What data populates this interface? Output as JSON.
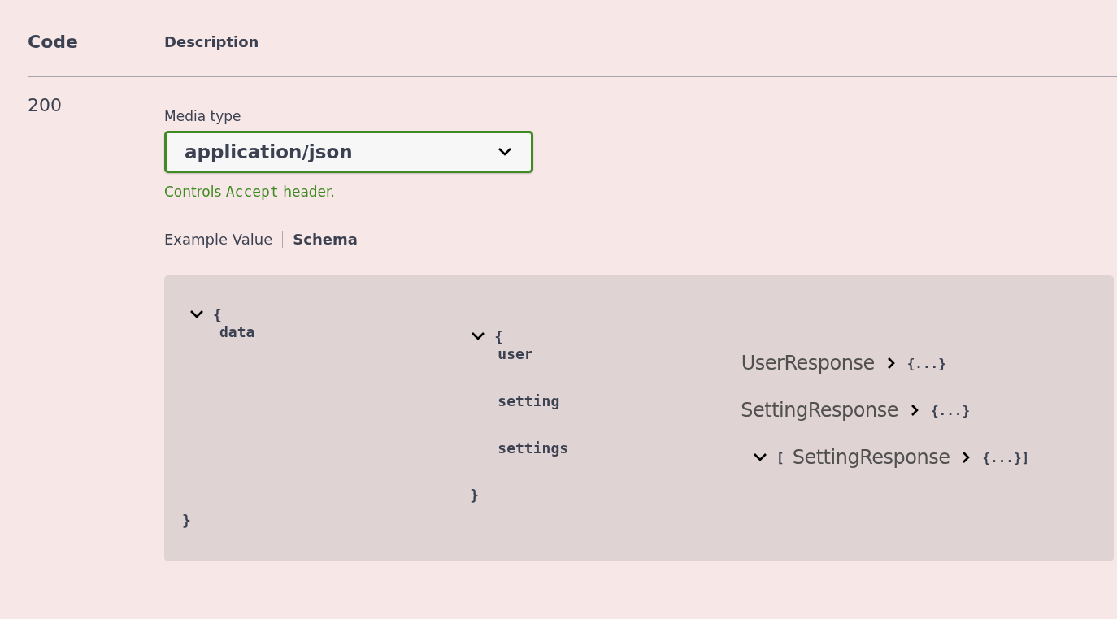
{
  "header": {
    "columns": [
      "Code",
      "Description"
    ]
  },
  "response": {
    "code": "200",
    "media_type_label": "Media type",
    "media_type": "application/json",
    "hint": {
      "before": "Controls ",
      "code": "Accept",
      "after": " header."
    },
    "tabs": [
      {
        "label": "Example Value",
        "selected": false
      },
      {
        "label": "Schema",
        "selected": true
      }
    ],
    "schema": {
      "open": "{",
      "close": "}",
      "expanded": true,
      "properties": [
        {
          "name": "data",
          "kind": "object",
          "value": {
            "open": "{",
            "close": "}",
            "expanded": true,
            "properties": [
              {
                "name": "user",
                "kind": "ref",
                "type": "UserResponse",
                "expanded": false,
                "collapsed": "{...}"
              },
              {
                "name": "setting",
                "kind": "ref",
                "type": "SettingResponse",
                "expanded": false,
                "collapsed": "{...}"
              },
              {
                "name": "settings",
                "kind": "array",
                "expanded": true,
                "open": "[",
                "type": "SettingResponse",
                "item_expanded": false,
                "collapsed": "{...}",
                "close": "]"
              }
            ]
          }
        }
      ]
    }
  }
}
